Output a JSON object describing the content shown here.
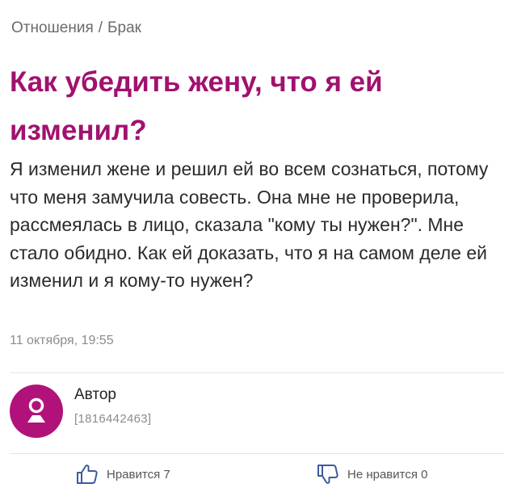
{
  "breadcrumb": {
    "category": "Отношения",
    "separator": "/",
    "subcategory": "Брак"
  },
  "question": {
    "title": "Как убедить жену, что я ей изменил?",
    "body": "Я изменил жене и решил ей во всем сознаться, потому что меня замучила совесть. Она мне не проверила, рассмеялась в лицо, сказала \"кому ты нужен?\". Мне стало обидно. Как ей доказать, что я на самом деле ей изменил и я кому-то нужен?",
    "timestamp": "11 октября, 19:55"
  },
  "author": {
    "name": "Автор",
    "id": "[1816442463]",
    "avatar_icon": "user-silhouette-icon"
  },
  "votes": {
    "like_label": "Нравится 7",
    "dislike_label": "Не нравится 0",
    "like_icon": "thumbs-up-icon",
    "dislike_icon": "thumbs-down-icon"
  },
  "colors": {
    "accent": "#a0126e",
    "avatar_bg": "#b0127a",
    "icon_blue": "#3d5a9e"
  }
}
